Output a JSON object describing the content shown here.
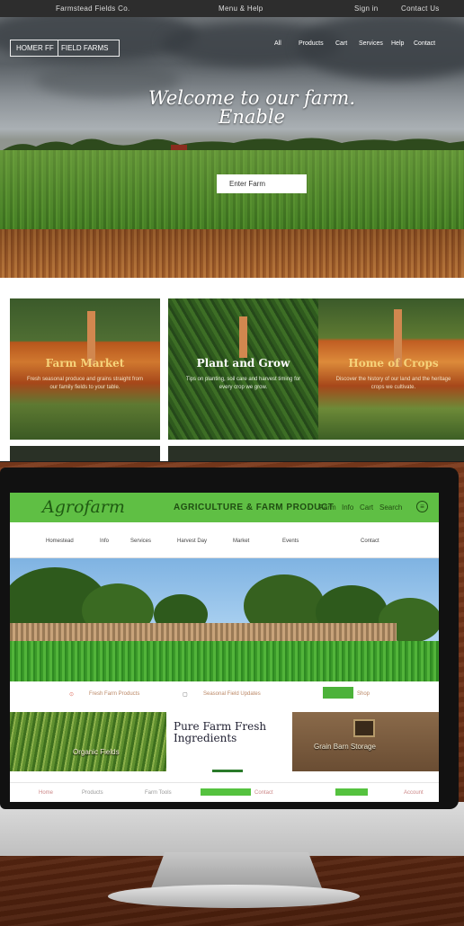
{
  "top": {
    "strip": {
      "left": "Farmstead Fields Co.",
      "center": "Menu & Help",
      "right1": "Sign in",
      "right2": "Contact Us"
    },
    "brand": {
      "left": "HOMER FF",
      "right": "FIELD FARMS"
    },
    "nav": [
      "All",
      "Products",
      "Cart",
      "Services",
      "Help",
      "Contact"
    ],
    "hero": {
      "title": "Welcome to our farm. Enable",
      "button": "Enter Farm"
    },
    "cards": [
      {
        "title": "Farm Market",
        "desc": "Fresh seasonal produce and grains straight from our family fields to your table."
      },
      {
        "title": "Plant and Grow",
        "desc": "Tips on planting, soil care and harvest timing for every crop we grow."
      },
      {
        "title": "Home of Crops",
        "desc": "Discover the history of our land and the heritage crops we cultivate."
      }
    ]
  },
  "monitor": {
    "logo": "Agrofarm",
    "tagline": "AGRICULTURE & FARM PRODUCT",
    "header_nav": [
      "Farm",
      "Info",
      "Cart",
      "Search",
      "Menu"
    ],
    "nav": [
      "Homestead",
      "Info",
      "Services",
      "Harvest Day",
      "Market",
      "Events",
      "Contact"
    ],
    "info_bar": [
      "Fresh Farm Products",
      "Seasonal Field Updates",
      "Shop"
    ],
    "cards": {
      "left": "Organic Fields",
      "center": "Pure Farm Fresh Ingredients",
      "right": "Grain Barn Storage"
    },
    "footer": [
      "Home",
      "Products",
      "Farm Tools",
      "Contact",
      "Shop Now",
      "Account"
    ]
  },
  "colors": {
    "brand_green": "#5fbf44",
    "button_green": "#4cb23a",
    "hero_text": "#ffffff",
    "wood": "#7c3a1c"
  }
}
